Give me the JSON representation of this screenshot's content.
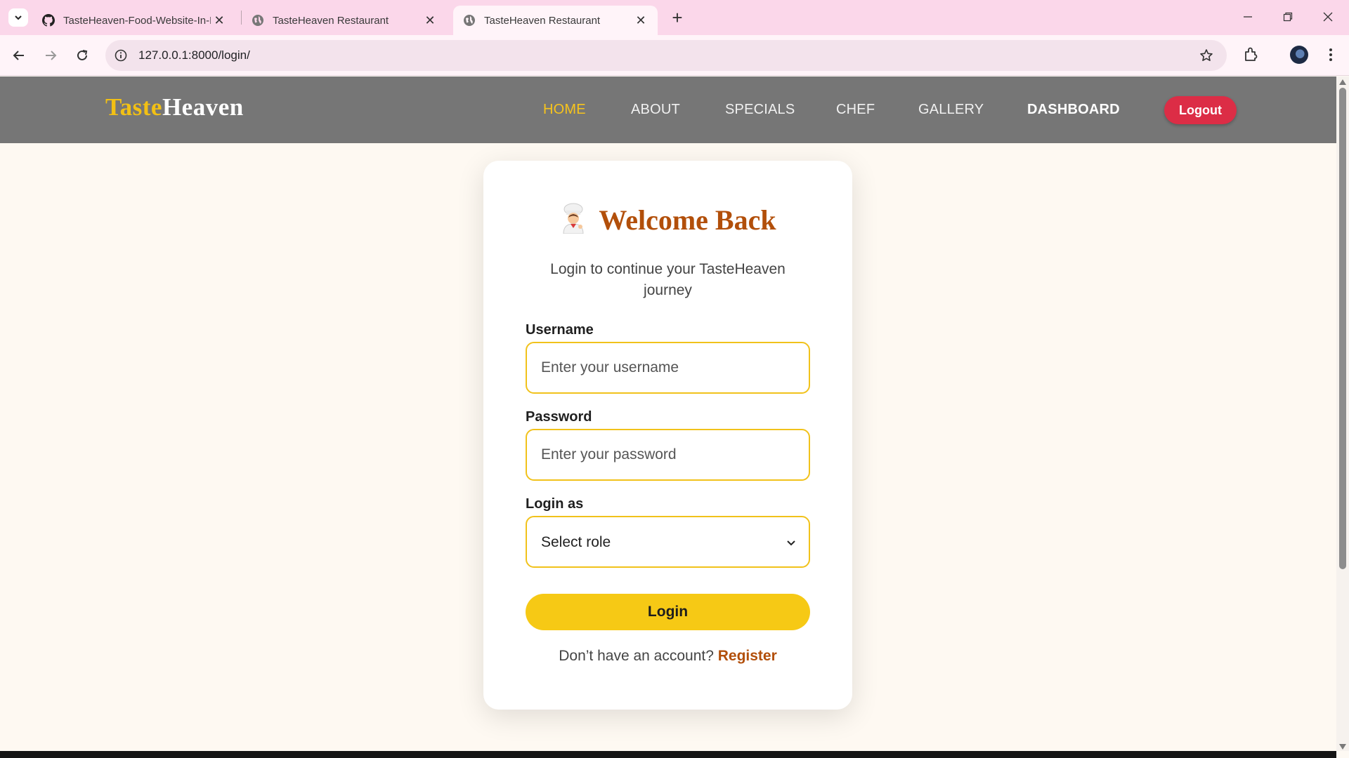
{
  "browser": {
    "tabs": [
      {
        "title": "TasteHeaven-Food-Website-In-Django",
        "icon": "github-icon"
      },
      {
        "title": "TasteHeaven Restaurant",
        "icon": "globe-icon"
      },
      {
        "title": "TasteHeaven Restaurant",
        "icon": "globe-icon",
        "active": true
      }
    ],
    "url": "127.0.0.1:8000/login/"
  },
  "header": {
    "logo_part1": "Taste",
    "logo_part2": "Heaven",
    "nav": {
      "home": "HOME",
      "about": "ABOUT",
      "specials": "SPECIALS",
      "chef": "CHEF",
      "gallery": "GALLERY",
      "dashboard": "DASHBOARD"
    },
    "logout": "Logout"
  },
  "login": {
    "title": "Welcome Back",
    "subtitle": "Login to continue your TasteHeaven journey",
    "username_label": "Username",
    "username_placeholder": "Enter your username",
    "password_label": "Password",
    "password_placeholder": "Enter your password",
    "role_label": "Login as",
    "role_value": "Select role",
    "submit": "Login",
    "register_prompt": "Don’t have an account?",
    "register_link": "Register"
  },
  "colors": {
    "accent": "#f6c915",
    "brand_brown": "#b24f0a",
    "header_bg": "#767676",
    "logout_red": "#dc2d46"
  }
}
